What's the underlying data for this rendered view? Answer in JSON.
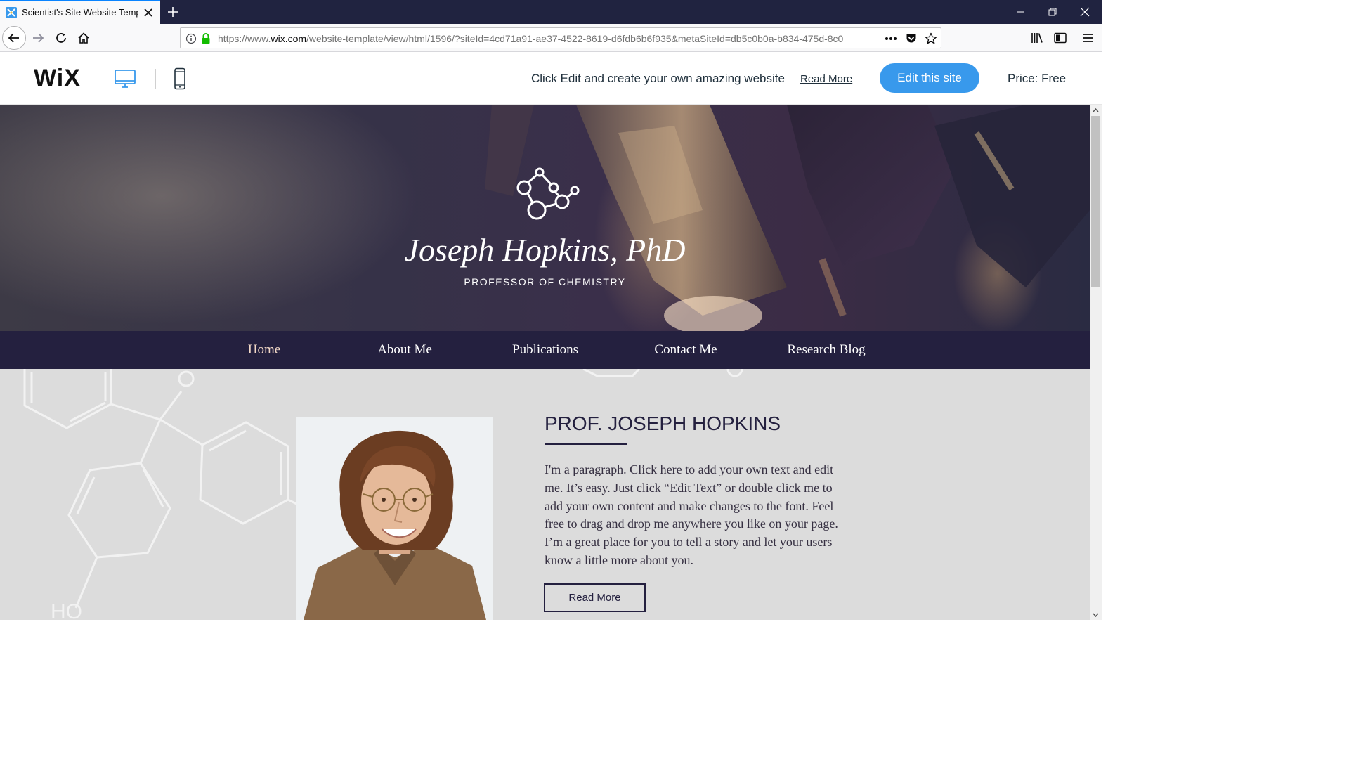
{
  "browser": {
    "tab_title": "Scientist's Site Website Template",
    "url_prefix": "https://www.",
    "url_domain": "wix.com",
    "url_path": "/website-template/view/html/1596/?siteId=4cd71a91-ae37-4522-8619-d6fdb6b6f935&metaSiteId=db5c0b0a-b834-475d-8c0"
  },
  "wix_bar": {
    "logo": "WiX",
    "promo_text": "Click Edit and create your own amazing website",
    "read_more": "Read More",
    "edit_button": "Edit this site",
    "price": "Price: Free",
    "colors": {
      "accent": "#3899ec"
    }
  },
  "hero": {
    "name": "Joseph Hopkins, PhD",
    "subtitle": "PROFESSOR OF CHEMISTRY"
  },
  "site_nav": {
    "items": [
      {
        "label": "Home",
        "active": true
      },
      {
        "label": "About Me"
      },
      {
        "label": "Publications"
      },
      {
        "label": "Contact Me"
      },
      {
        "label": "Research Blog"
      }
    ]
  },
  "bio": {
    "title": "PROF. JOSEPH HOPKINS",
    "paragraph": "I'm a paragraph. Click here to add your own text and edit me. It’s easy. Just click “Edit Text” or double click me to add your own content and make changes to the font. Feel free to drag and drop me anywhere you like on your page. I’m a great place for you to tell a story and let your users know a little more about you.",
    "button": "Read More",
    "molecule_labels": {
      "ho": "HO"
    }
  },
  "theme": {
    "nav_bg": "#24203f",
    "content_bg": "#dcdcdc"
  }
}
